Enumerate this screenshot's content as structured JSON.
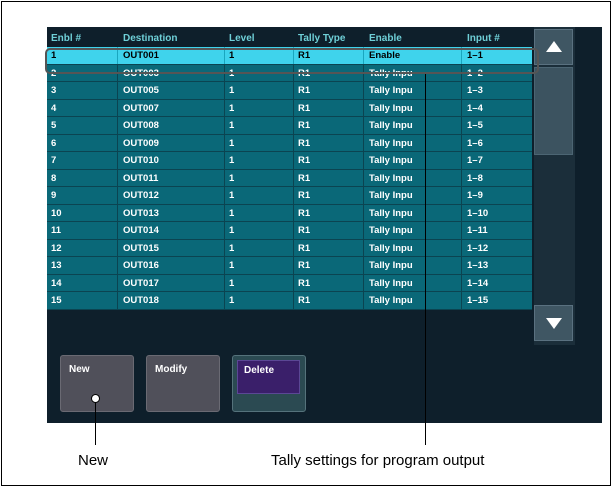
{
  "table": {
    "headers": [
      "Enbl #",
      "Destination",
      "Level",
      "Tally Type",
      "Enable",
      "Input #"
    ],
    "rows": [
      [
        "1",
        "OUT001",
        "1",
        "R1",
        "Enable",
        "1–1"
      ],
      [
        "2",
        "OUT003",
        "1",
        "R1",
        "Tally Inpu",
        "1–2"
      ],
      [
        "3",
        "OUT005",
        "1",
        "R1",
        "Tally Inpu",
        "1–3"
      ],
      [
        "4",
        "OUT007",
        "1",
        "R1",
        "Tally Inpu",
        "1–4"
      ],
      [
        "5",
        "OUT008",
        "1",
        "R1",
        "Tally Inpu",
        "1–5"
      ],
      [
        "6",
        "OUT009",
        "1",
        "R1",
        "Tally Inpu",
        "1–6"
      ],
      [
        "7",
        "OUT010",
        "1",
        "R1",
        "Tally Inpu",
        "1–7"
      ],
      [
        "8",
        "OUT011",
        "1",
        "R1",
        "Tally Inpu",
        "1–8"
      ],
      [
        "9",
        "OUT012",
        "1",
        "R1",
        "Tally Inpu",
        "1–9"
      ],
      [
        "10",
        "OUT013",
        "1",
        "R1",
        "Tally Inpu",
        "1–10"
      ],
      [
        "11",
        "OUT014",
        "1",
        "R1",
        "Tally Inpu",
        "1–11"
      ],
      [
        "12",
        "OUT015",
        "1",
        "R1",
        "Tally Inpu",
        "1–12"
      ],
      [
        "13",
        "OUT016",
        "1",
        "R1",
        "Tally Inpu",
        "1–13"
      ],
      [
        "14",
        "OUT017",
        "1",
        "R1",
        "Tally Inpu",
        "1–14"
      ],
      [
        "15",
        "OUT018",
        "1",
        "R1",
        "Tally Inpu",
        "1–15"
      ]
    ],
    "selected_row": 0
  },
  "buttons": {
    "new_label": "New",
    "modify_label": "Modify",
    "delete_label": "Delete"
  },
  "scrollbar": {
    "up_icon": "triangle-up-icon",
    "down_icon": "triangle-down-icon"
  },
  "callouts": {
    "new_label": "New",
    "tally_label": "Tally settings for program output"
  },
  "colors": {
    "panel_bg": "#0e1f2b",
    "row_bg": "#0a6878",
    "selected_row_bg": "#3fd3ec",
    "header_text": "#6fd0d8",
    "delete_inner": "#3a1f6a"
  }
}
